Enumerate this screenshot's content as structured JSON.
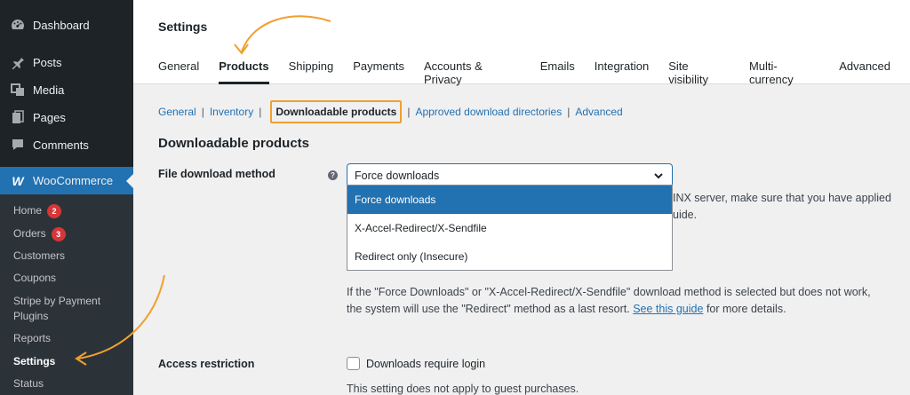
{
  "sidebar": {
    "items": [
      {
        "label": "Dashboard",
        "icon": "dashboard-icon"
      },
      {
        "label": "Posts",
        "icon": "pin-icon"
      },
      {
        "label": "Media",
        "icon": "media-icon"
      },
      {
        "label": "Pages",
        "icon": "pages-icon"
      },
      {
        "label": "Comments",
        "icon": "comments-icon"
      },
      {
        "label": "WooCommerce",
        "icon": "woocommerce-icon"
      }
    ],
    "submenu": {
      "home": "Home",
      "home_badge": "2",
      "orders": "Orders",
      "orders_badge": "3",
      "customers": "Customers",
      "coupons": "Coupons",
      "stripe_line1": "Stripe by Payment",
      "stripe_line2": "Plugins",
      "reports": "Reports",
      "settings": "Settings",
      "status": "Status"
    }
  },
  "header": {
    "title": "Settings",
    "tabs": [
      "General",
      "Products",
      "Shipping",
      "Payments",
      "Accounts & Privacy",
      "Emails",
      "Integration",
      "Site visibility",
      "Multi-currency",
      "Advanced"
    ],
    "active_tab": "Products"
  },
  "subsections": {
    "general": "General",
    "inventory": "Inventory",
    "downloadable": "Downloadable products",
    "approved": "Approved download directories",
    "advanced": "Advanced",
    "separator": "|"
  },
  "section": {
    "title": "Downloadable products"
  },
  "file_download": {
    "label": "File download method",
    "help": "?",
    "selected": "Force downloads",
    "options": [
      "Force downloads",
      "X-Accel-Redirect/X-Sendfile",
      "Redirect only (Insecure)"
    ],
    "behind_text_1": "INX server, make sure that you have applied",
    "behind_text_2": "uide.",
    "note_line1": "If the \"Force Downloads\" or \"X-Accel-Redirect/X-Sendfile\" download method is selected but does not work,",
    "note_line2_pre": "the system will use the \"Redirect\" method as a last resort.",
    "note_link": "See this guide",
    "note_line2_post": "for more details."
  },
  "access_restriction": {
    "label": "Access restriction",
    "checkbox_label": "Downloads require login",
    "checked": false,
    "description": "This setting does not apply to guest purchases."
  },
  "colors": {
    "sidebar_bg": "#1d2327",
    "accent": "#2271b1",
    "highlight": "#f0a030",
    "badge": "#d63638"
  }
}
